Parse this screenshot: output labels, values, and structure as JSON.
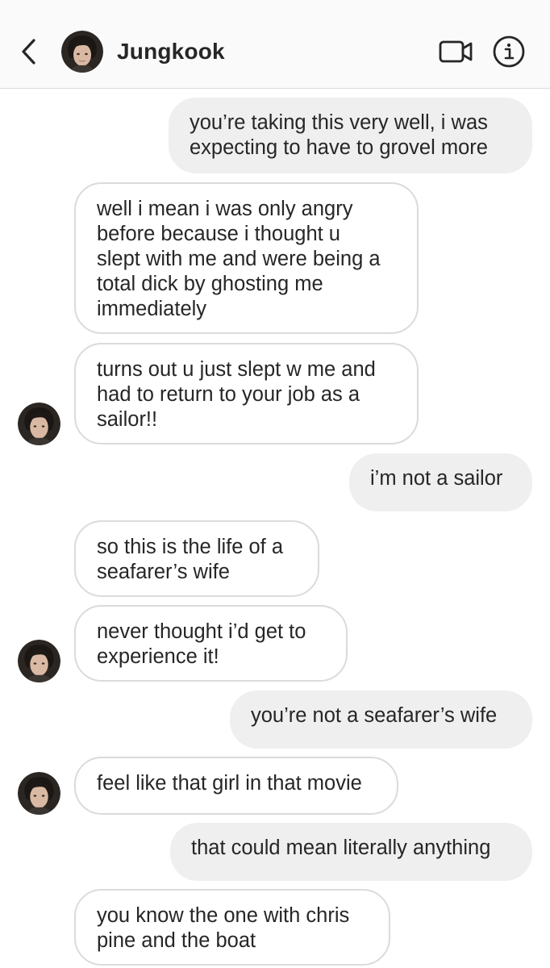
{
  "header": {
    "contact_name": "Jungkook",
    "back_icon": "chevron-left-icon",
    "video_icon": "video-camera-icon",
    "info_icon": "info-icon"
  },
  "messages": [
    {
      "direction": "outgoing",
      "text": "you’re taking this very well, i was\nexpecting to have to grovel more"
    },
    {
      "direction": "incoming",
      "text": "well i mean i was only angry\nbefore because i thought u\nslept with me and were being a\ntotal dick by ghosting me\nimmediately"
    },
    {
      "direction": "incoming",
      "text": "turns out u just slept w me and\nhad to return to your job as a\nsailor!!"
    },
    {
      "direction": "outgoing",
      "text": "i’m not a sailor"
    },
    {
      "direction": "incoming",
      "text": "so this is the life of a\nseafarer’s wife"
    },
    {
      "direction": "incoming",
      "text": "never thought i’d get to\nexperience it!"
    },
    {
      "direction": "outgoing",
      "text": "you’re not a seafarer’s wife"
    },
    {
      "direction": "incoming",
      "text": "feel like that girl in that movie"
    },
    {
      "direction": "outgoing",
      "text": "that could mean literally anything"
    },
    {
      "direction": "incoming",
      "text": "you know the one with chris\npine and the boat"
    }
  ],
  "colors": {
    "header_bg": "#fafafa",
    "outgoing_bubble": "#efefef",
    "incoming_border": "#dbdbdb",
    "text": "#262626"
  }
}
